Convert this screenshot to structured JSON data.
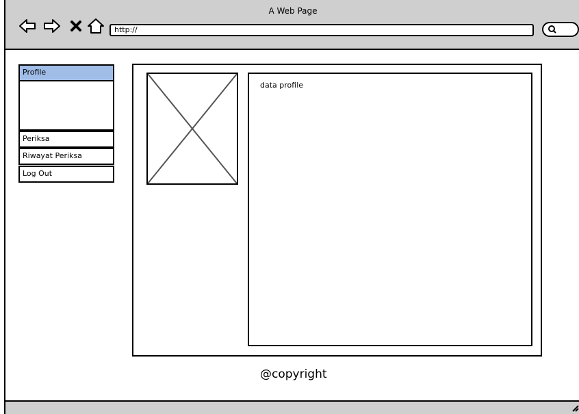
{
  "window": {
    "title": "A Web Page",
    "address": "http://"
  },
  "icons": {
    "back": "back-arrow-icon",
    "forward": "forward-arrow-icon",
    "stop": "close-icon",
    "home": "home-icon",
    "search": "search-icon",
    "resize": "resize-grip-icon"
  },
  "sidebar": {
    "items": [
      {
        "label": "Profile",
        "active": true
      },
      {
        "label": "Periksa"
      },
      {
        "label": "Riwayat Periksa"
      },
      {
        "label": "Log Out"
      }
    ]
  },
  "main": {
    "profile_text": "data profile"
  },
  "footer": {
    "copyright": "@copyright"
  },
  "colors": {
    "chrome": "#cfcfcf",
    "active_item": "#a0bde8"
  }
}
